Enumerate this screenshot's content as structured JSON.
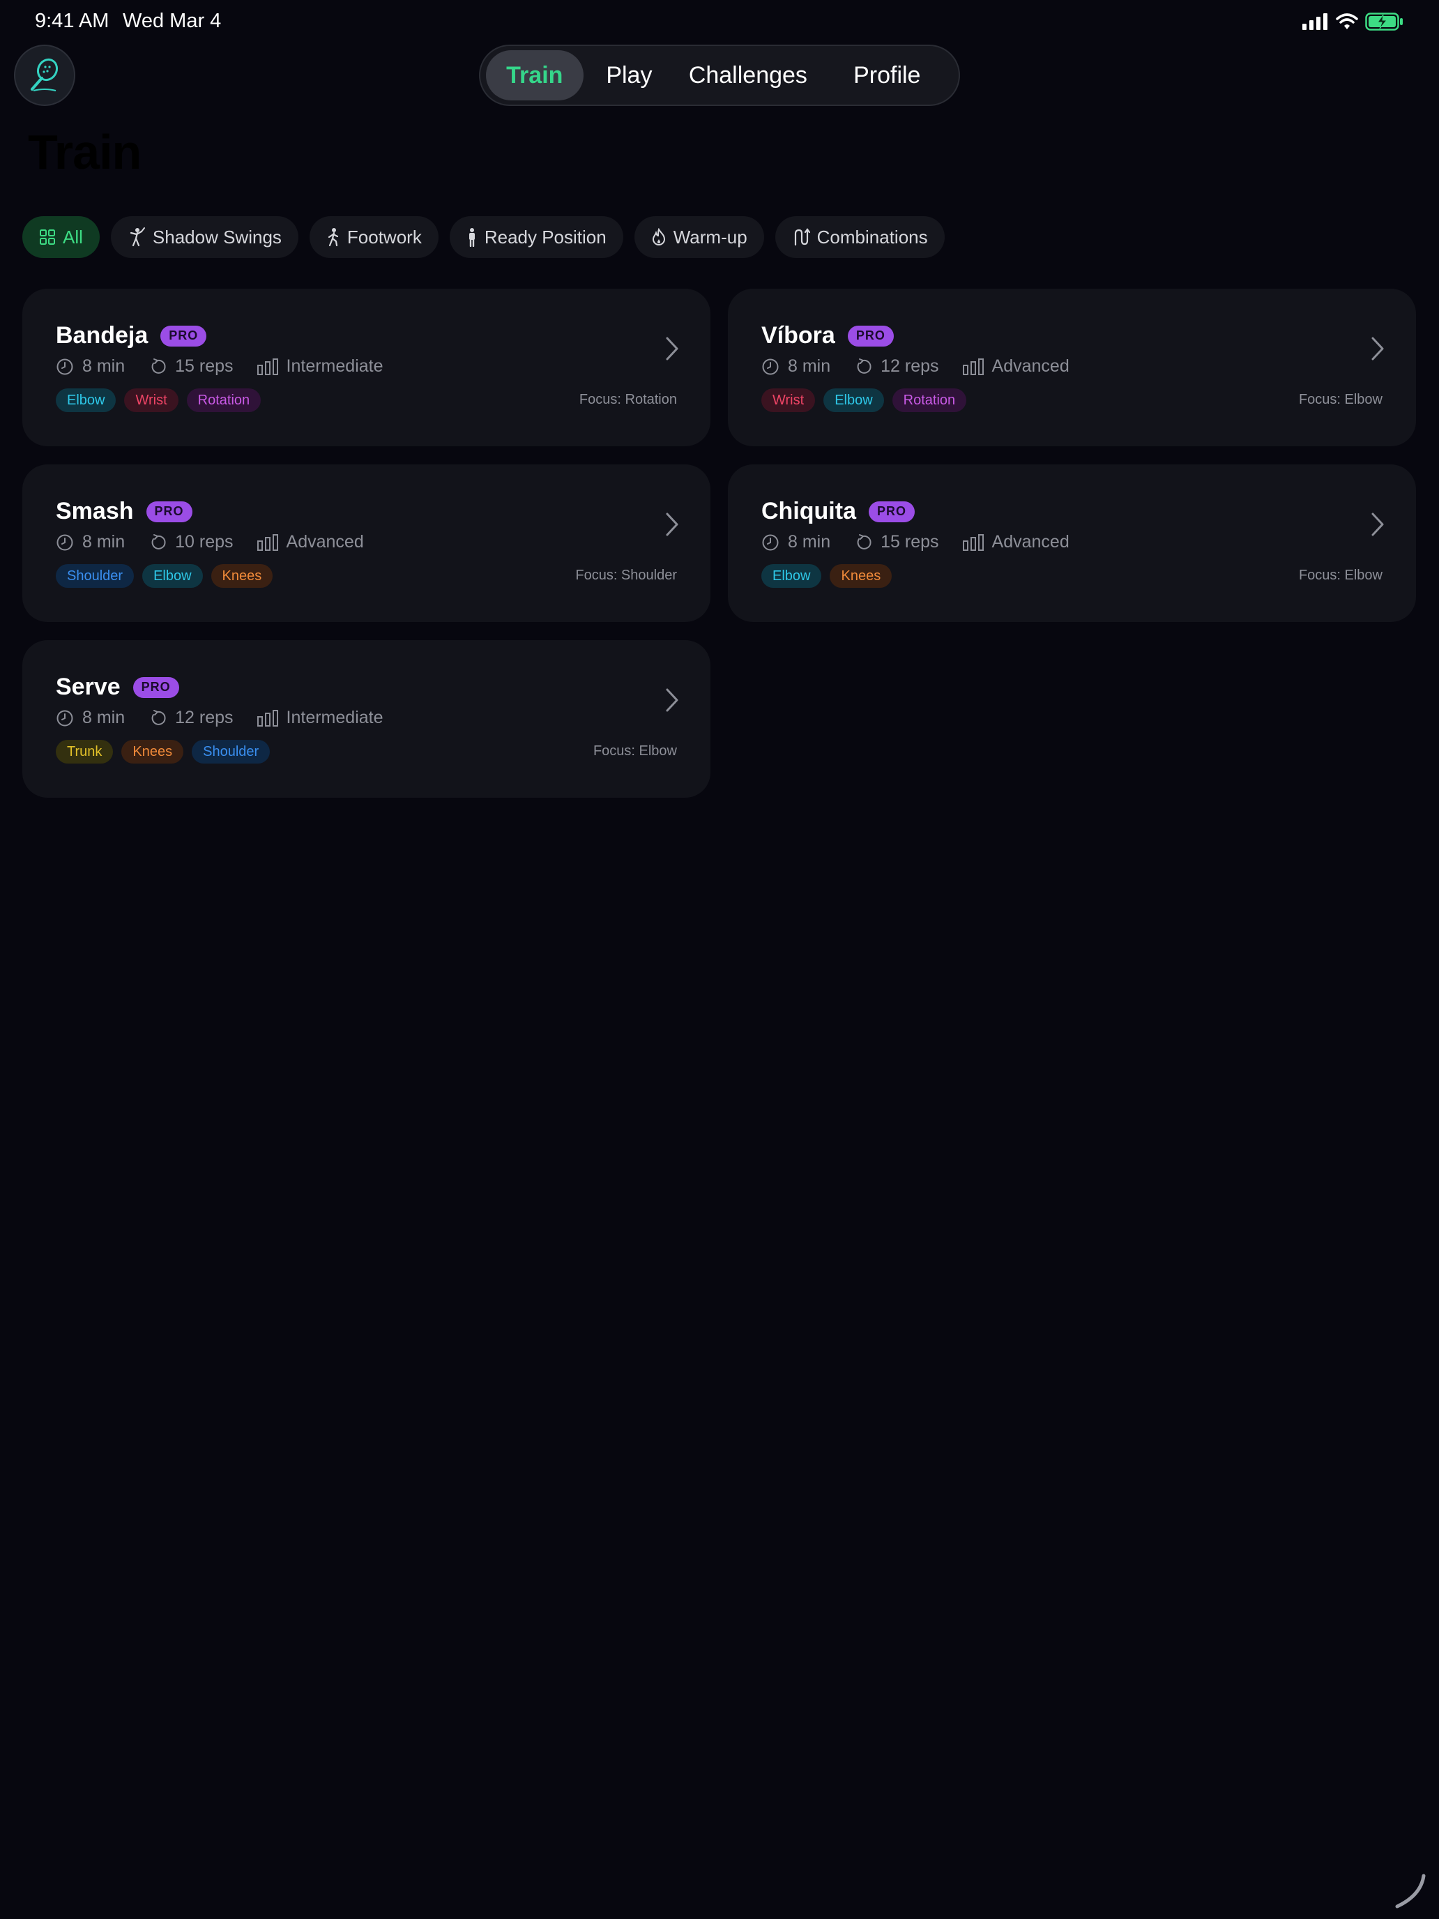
{
  "status": {
    "time": "9:41 AM",
    "date": "Wed Mar 4"
  },
  "nav": {
    "tabs": [
      "Train",
      "Play",
      "Challenges",
      "Profile"
    ],
    "active": "Train"
  },
  "page": {
    "title": "Train"
  },
  "filters": [
    "All",
    "Shadow Swings",
    "Footwork",
    "Ready Position",
    "Warm-up",
    "Combinations"
  ],
  "pro_label": "PRO",
  "colors": {
    "accent": "#35d68a",
    "pro": "#9b4de6",
    "background": "#07070f",
    "card": "#12131a"
  },
  "cards": [
    {
      "title": "Bandeja",
      "duration": "8 min",
      "reps": "15 reps",
      "level": "Intermediate",
      "tags": [
        "Elbow",
        "Wrist",
        "Rotation"
      ],
      "focus": "Focus: Rotation"
    },
    {
      "title": "Víbora",
      "duration": "8 min",
      "reps": "12 reps",
      "level": "Advanced",
      "tags": [
        "Wrist",
        "Elbow",
        "Rotation"
      ],
      "focus": "Focus: Elbow"
    },
    {
      "title": "Smash",
      "duration": "8 min",
      "reps": "10 reps",
      "level": "Advanced",
      "tags": [
        "Shoulder",
        "Elbow",
        "Knees"
      ],
      "focus": "Focus: Shoulder"
    },
    {
      "title": "Chiquita",
      "duration": "8 min",
      "reps": "15 reps",
      "level": "Advanced",
      "tags": [
        "Elbow",
        "Knees"
      ],
      "focus": "Focus: Elbow"
    },
    {
      "title": "Serve",
      "duration": "8 min",
      "reps": "12 reps",
      "level": "Intermediate",
      "tags": [
        "Trunk",
        "Knees",
        "Shoulder"
      ],
      "focus": "Focus: Elbow"
    }
  ]
}
